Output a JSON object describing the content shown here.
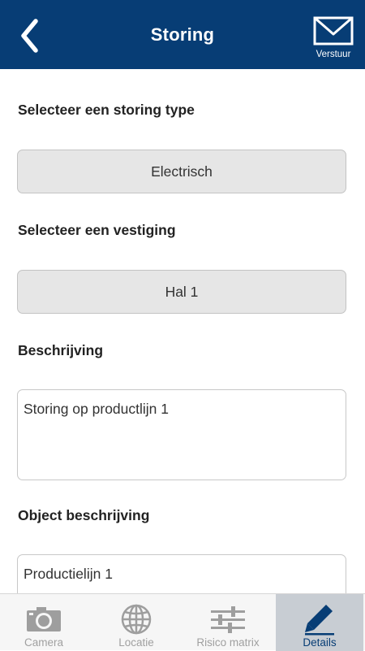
{
  "header": {
    "title": "Storing",
    "send_label": "Verstuur",
    "icons": {
      "back": "chevron-left-icon",
      "send": "envelope-icon"
    },
    "background": "#073d75"
  },
  "form": {
    "storing_type": {
      "label": "Selecteer een storing type",
      "value": "Electrisch"
    },
    "vestiging": {
      "label": "Selecteer een vestiging",
      "value": "Hal 1"
    },
    "beschrijving": {
      "label": "Beschrijving",
      "value": "Storing op productlijn 1"
    },
    "object_beschrijving": {
      "label": "Object beschrijving",
      "value": "Productielijn 1"
    }
  },
  "tabs": [
    {
      "label": "Camera",
      "icon": "camera-icon",
      "active": false
    },
    {
      "label": "Locatie",
      "icon": "globe-icon",
      "active": false
    },
    {
      "label": "Risico matrix",
      "icon": "sliders-icon",
      "active": false
    },
    {
      "label": "Details",
      "icon": "pencil-icon",
      "active": true
    }
  ],
  "colors": {
    "accent": "#073d75",
    "active_tab_bg": "#c8cdd3",
    "inactive_tab": "#a0a0a0"
  }
}
